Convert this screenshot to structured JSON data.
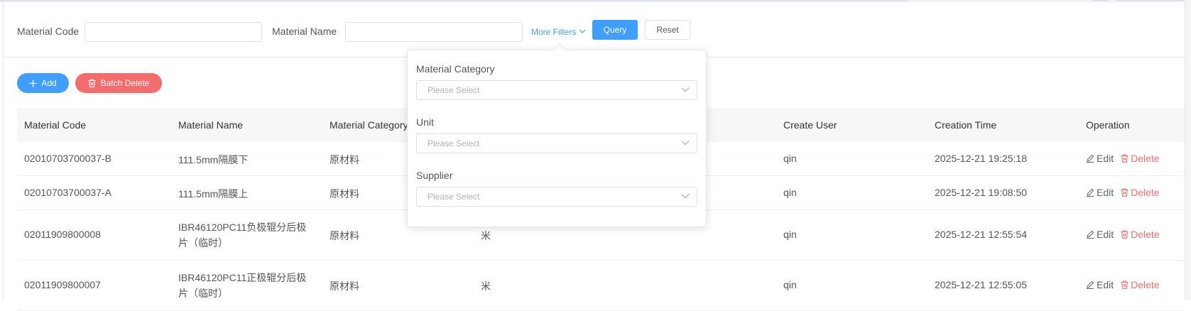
{
  "filters": {
    "material_code_label": "Material Code",
    "material_name_label": "Material Name",
    "more_filters_label": "More Filters",
    "query_label": "Query",
    "reset_label": "Reset"
  },
  "toolbar": {
    "add_label": "Add",
    "batch_delete_label": "Batch Delete"
  },
  "popover": {
    "fields": [
      {
        "label": "Material Category",
        "placeholder": "Please Select"
      },
      {
        "label": "Unit",
        "placeholder": "Please Select"
      },
      {
        "label": "Supplier",
        "placeholder": "Please Select"
      }
    ]
  },
  "table": {
    "headers": {
      "code": "Material Code",
      "name": "Material Name",
      "category": "Material Category",
      "create_user": "Create User",
      "creation_time": "Creation Time",
      "operation": "Operation"
    },
    "rows": [
      {
        "code": "02010703700037-B",
        "name": "111.5mm隔膜下",
        "category": "原材料",
        "unit": "",
        "create_user": "qin",
        "creation_time": "2025-12-21 19:25:18",
        "edit": "Edit",
        "delete": "Delete"
      },
      {
        "code": "02010703700037-A",
        "name": "111.5mm隔膜上",
        "category": "原材料",
        "unit": "",
        "create_user": "qin",
        "creation_time": "2025-12-21 19:08:50",
        "edit": "Edit",
        "delete": "Delete"
      },
      {
        "code": "02011909800008",
        "name": "IBR46120PC11负极辊分后极片（临时）",
        "category": "原材料",
        "unit": "米",
        "create_user": "qin",
        "creation_time": "2025-12-21 12:55:54",
        "edit": "Edit",
        "delete": "Delete"
      },
      {
        "code": "02011909800007",
        "name": "IBR46120PC11正极辊分后极片（临时）",
        "category": "原材料",
        "unit": "米",
        "create_user": "qin",
        "creation_time": "2025-12-21 12:55:05",
        "edit": "Edit",
        "delete": "Delete"
      }
    ]
  },
  "colors": {
    "primary": "#409eff",
    "danger": "#f56c6c"
  }
}
